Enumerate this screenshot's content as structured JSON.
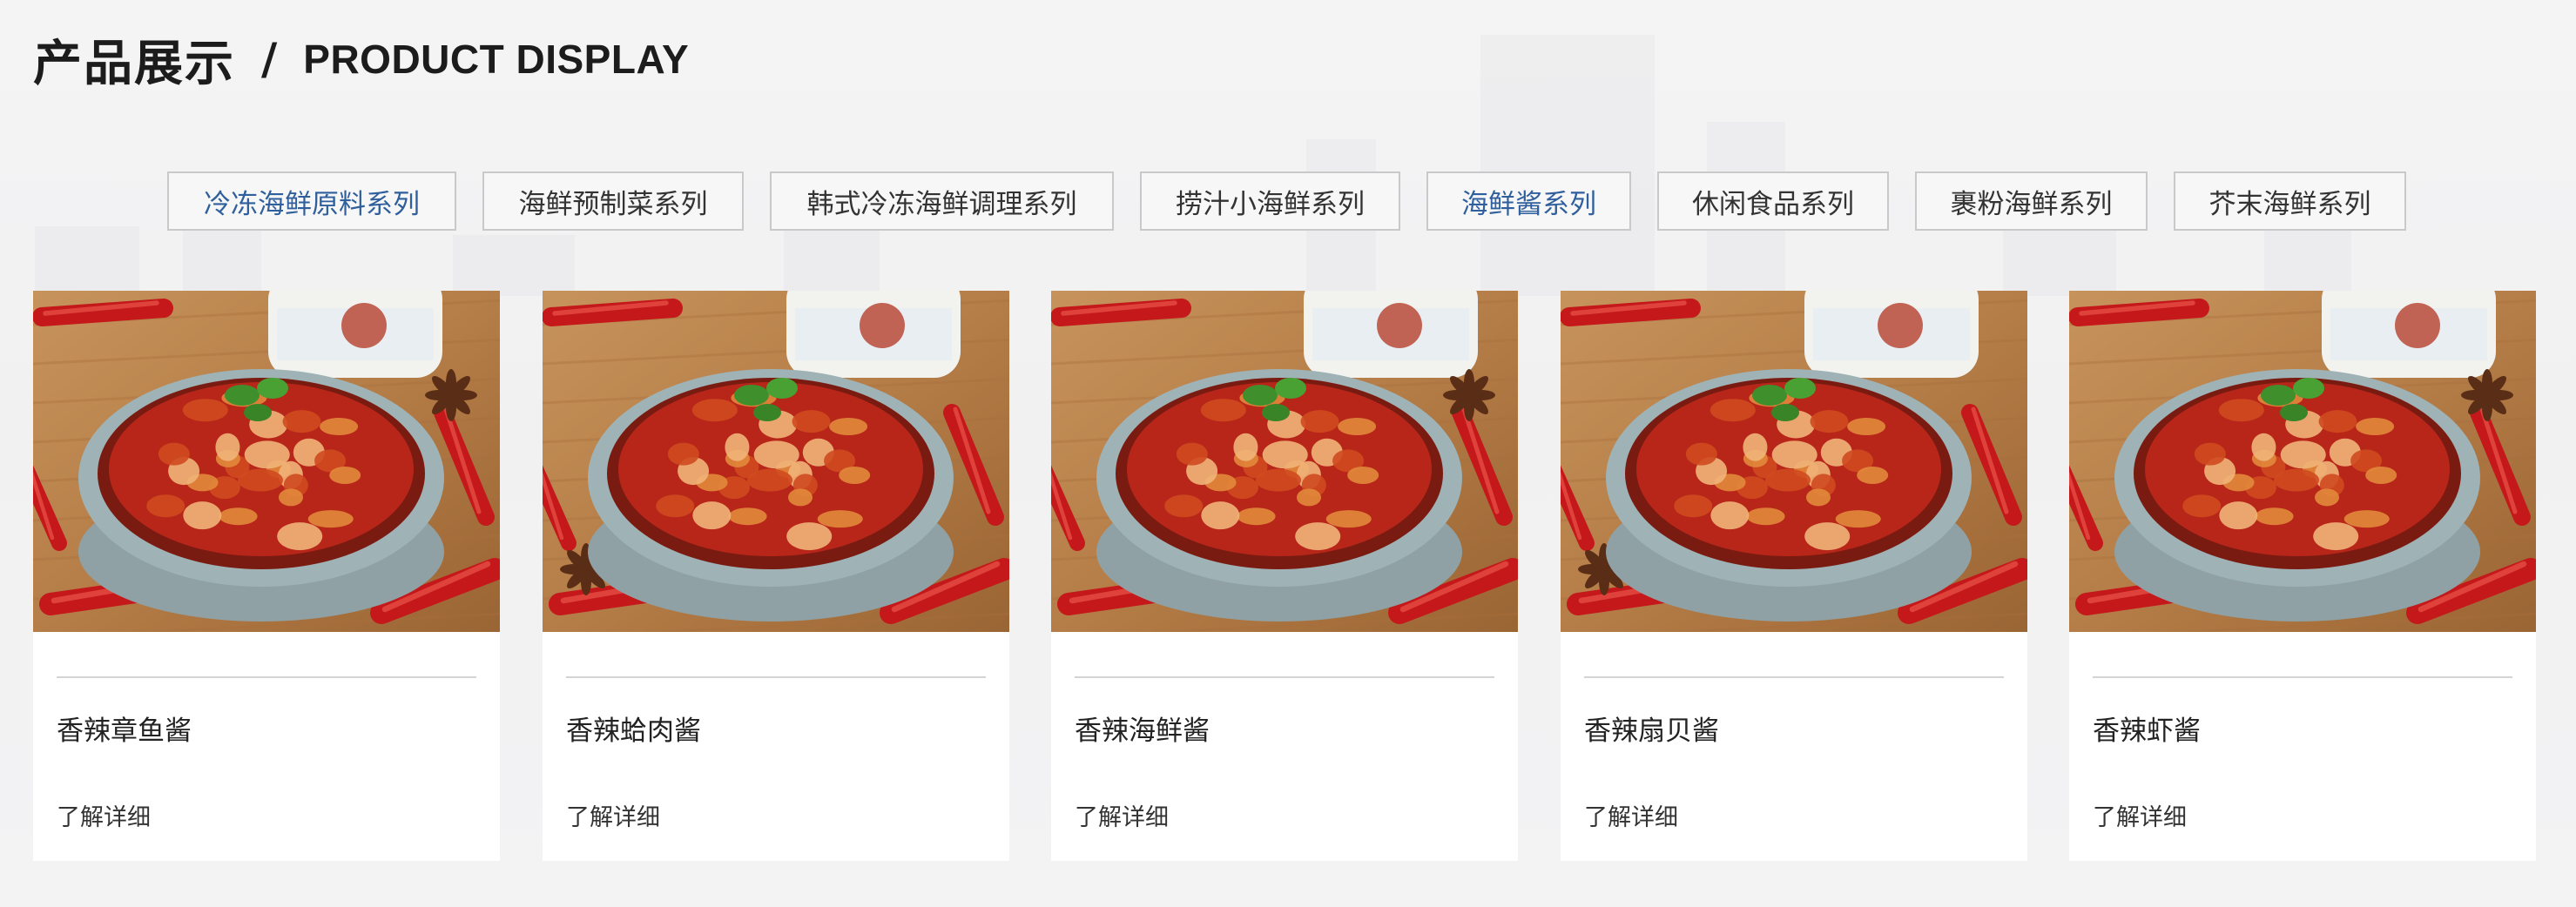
{
  "header": {
    "title_cn": "产品展示",
    "separator": "/",
    "title_en": "PRODUCT DISPLAY"
  },
  "tabs": [
    {
      "label": "冷冻海鲜原料系列",
      "active": true
    },
    {
      "label": "海鲜预制菜系列",
      "active": false
    },
    {
      "label": "韩式冷冻海鲜调理系列",
      "active": false
    },
    {
      "label": "捞汁小海鲜系列",
      "active": false
    },
    {
      "label": "海鲜酱系列",
      "active": true
    },
    {
      "label": "休闲食品系列",
      "active": false
    },
    {
      "label": "裹粉海鲜系列",
      "active": false
    },
    {
      "label": "芥末海鲜系列",
      "active": false
    }
  ],
  "products": [
    {
      "name": "香辣章鱼酱",
      "more": "了解详细"
    },
    {
      "name": "香辣蛤肉酱",
      "more": "了解详细"
    },
    {
      "name": "香辣海鲜酱",
      "more": "了解详细"
    },
    {
      "name": "香辣扇贝酱",
      "more": "了解详细"
    },
    {
      "name": "香辣虾酱",
      "more": "了解详细"
    }
  ],
  "colors": {
    "accent_blue": "#2f5f9c",
    "tab_border": "#c9c9c9",
    "sauce_red": "#b8261a",
    "bowl_gray": "#8fa1a4"
  }
}
